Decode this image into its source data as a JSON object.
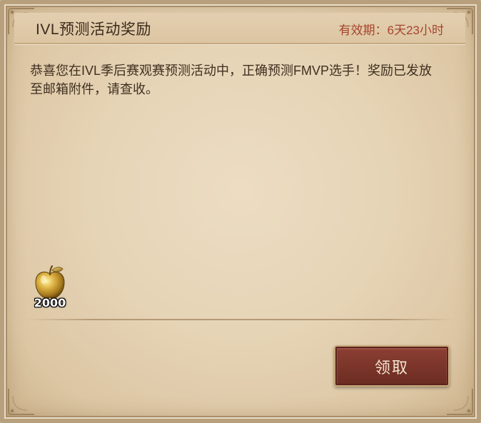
{
  "mail": {
    "title": "IVL预测活动奖励",
    "validity": "有效期：6天23小时",
    "message": "恭喜您在IVL季后赛观赛预测活动中，正确预测FMVP选手！奖励已发放至邮箱附件，请查收。"
  },
  "reward": {
    "icon": "golden-apple-icon",
    "count": "2000"
  },
  "actions": {
    "claim_label": "领取"
  },
  "colors": {
    "parchment": "#e6d4b6",
    "title_text": "#3b2a1c",
    "validity_text": "#a6452c",
    "button_bg": "#7a3429",
    "button_text": "#f2e6d2"
  }
}
